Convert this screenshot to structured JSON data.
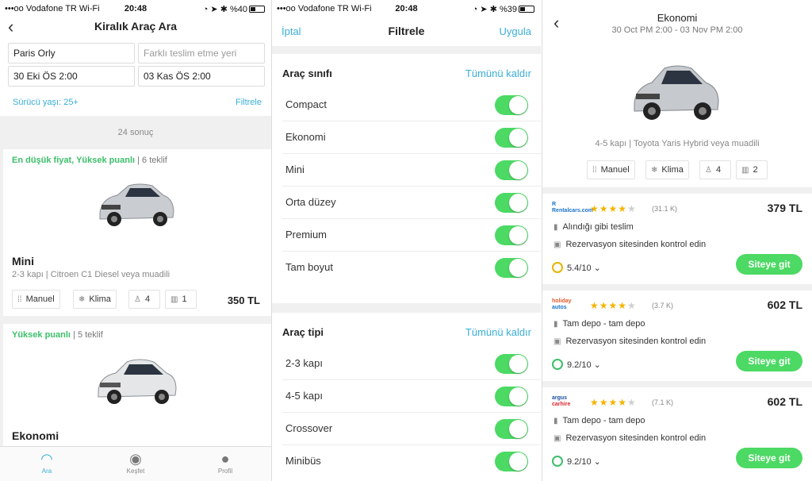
{
  "status1": {
    "carrier": "•••oo Vodafone TR Wi-Fi",
    "time": "20:48",
    "battery": "%40"
  },
  "status2": {
    "carrier": "•••oo Vodafone TR Wi-Fi",
    "time": "20:48",
    "battery": "%39"
  },
  "search": {
    "title": "Kiralık Araç Ara",
    "pickup_location": "Paris Orly",
    "dropoff_placeholder": "Farklı teslim etme yeri",
    "pickup_date": "30 Eki ÖS 2:00",
    "dropoff_date": "03 Kas ÖS 2:00",
    "driver_age": "Sürücü yaşı: 25+",
    "filter_link": "Filtrele",
    "results_count": "24 sonuç"
  },
  "cards": [
    {
      "tag_highlight": "En düşük fiyat, Yüksek puanlı",
      "tag_rest": " | 6 teklif",
      "model": "Mini",
      "desc": "2-3 kapı | Citroen C1 Diesel veya muadili",
      "transmission": "Manuel",
      "ac": "Klima",
      "seats": "4",
      "bags": "1",
      "price": "350 TL"
    },
    {
      "tag_highlight": "Yüksek puanlı",
      "tag_rest": " | 5 teklif",
      "model": "Ekonomi"
    }
  ],
  "tabs": [
    {
      "label": "Ara"
    },
    {
      "label": "Keşfet"
    },
    {
      "label": "Profil"
    }
  ],
  "filter": {
    "cancel": "İptal",
    "title": "Filtrele",
    "apply": "Uygula",
    "class_header": "Araç sınıfı",
    "class_clear": "Tümünü kaldır",
    "classes": [
      "Compact",
      "Ekonomi",
      "Mini",
      "Orta düzey",
      "Premium",
      "Tam boyut"
    ],
    "type_header": "Araç tipi",
    "type_clear": "Tümünü kaldır",
    "types": [
      "2-3 kapı",
      "4-5 kapı",
      "Crossover",
      "Minibüs"
    ]
  },
  "detail": {
    "title": "Ekonomi",
    "dates": "30 Oct PM 2:00 - 03 Nov PM 2:00",
    "desc": "4-5 kapı | Toyota Yaris Hybrid veya muadili",
    "transmission": "Manuel",
    "ac": "Klima",
    "seats": "4",
    "bags": "2",
    "offers": [
      {
        "logo_a": "R",
        "logo_b": "Rentalcars.com",
        "stars": 4,
        "reviews": "(31.1 K)",
        "price": "379 TL",
        "feature1": "Alındığı gibi teslim",
        "feature2": "Rezervasyon sitesinden kontrol edin",
        "score": "5.4/10",
        "button": "Siteye git"
      },
      {
        "logo_a": "holiday",
        "logo_b": "autos",
        "stars": 4,
        "reviews": "(3.7 K)",
        "price": "602 TL",
        "feature1": "Tam depo - tam depo",
        "feature2": "Rezervasyon sitesinden kontrol edin",
        "score": "9.2/10",
        "button": "Siteye git"
      },
      {
        "logo_a": "argus",
        "logo_b": "carhire",
        "stars": 4,
        "reviews": "(7.1 K)",
        "price": "602 TL",
        "feature1": "Tam depo - tam depo",
        "feature2": "Rezervasyon sitesinden kontrol edin",
        "score": "9.2/10",
        "button": "Siteye git"
      }
    ]
  },
  "colors": {
    "accent_blue": "#3aaed8",
    "accent_green": "#4cd964",
    "tag_green": "#3cbf6a",
    "star": "#f5b301"
  }
}
